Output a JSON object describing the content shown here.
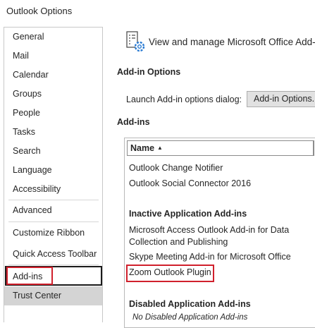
{
  "window": {
    "title": "Outlook Options"
  },
  "sidebar": {
    "items": [
      {
        "label": "General"
      },
      {
        "label": "Mail"
      },
      {
        "label": "Calendar"
      },
      {
        "label": "Groups"
      },
      {
        "label": "People"
      },
      {
        "label": "Tasks"
      },
      {
        "label": "Search"
      },
      {
        "label": "Language"
      },
      {
        "label": "Accessibility"
      },
      {
        "label": "Advanced"
      },
      {
        "label": "Customize Ribbon"
      },
      {
        "label": "Quick Access Toolbar"
      },
      {
        "label": "Add-ins"
      },
      {
        "label": "Trust Center"
      }
    ],
    "selected": "Add-ins"
  },
  "main": {
    "header": {
      "icon": "addins-gear-icon",
      "text": "View and manage Microsoft Office Add-"
    },
    "addin_options": {
      "heading": "Add-in Options",
      "launch_label": "Launch Add-in options dialog:",
      "button_label": "Add-in Options..."
    },
    "addins": {
      "heading": "Add-ins",
      "column_header": "Name",
      "sort_indicator": "▲",
      "rows": [
        {
          "text": "Outlook Change Notifier"
        },
        {
          "text": "Outlook Social Connector 2016"
        },
        {
          "text": "Inactive Application Add-ins"
        },
        {
          "text": "Microsoft Access Outlook Add-in for Data"
        },
        {
          "text": "Collection and Publishing"
        },
        {
          "text": "Skype Meeting Add-in for Microsoft Office"
        },
        {
          "text": "Zoom Outlook Plugin"
        },
        {
          "text": "Disabled Application Add-ins"
        },
        {
          "text": "No Disabled Application Add-ins"
        }
      ]
    }
  },
  "colors": {
    "highlight_red": "#d0202c",
    "selected_bg": "#d4d4d4"
  }
}
